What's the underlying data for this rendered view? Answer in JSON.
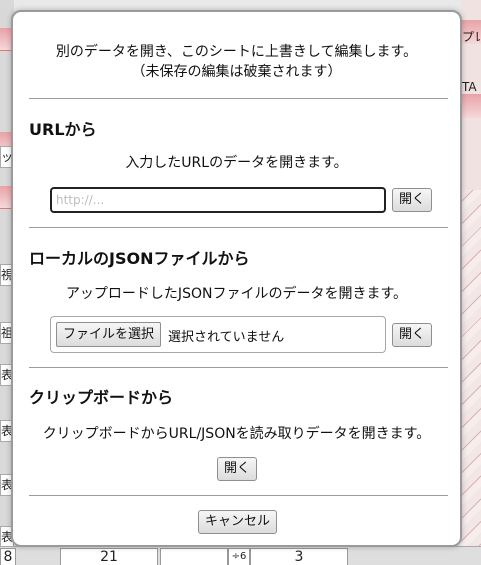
{
  "background": {
    "left_chars": [
      "ッ",
      "視",
      "祖",
      "表",
      "表",
      "表",
      "表",
      "8"
    ],
    "right_chars": [
      "プレ",
      "TA"
    ],
    "bottom_cells": [
      "21",
      "÷6",
      "3"
    ]
  },
  "dialog": {
    "intro_line1": "別のデータを開き、このシートに上書きして編集します。",
    "intro_line2": "（未保存の編集は破棄されます）",
    "url": {
      "heading": "URLから",
      "description": "入力したURLのデータを開きます。",
      "placeholder": "http://...",
      "open_label": "開く"
    },
    "json": {
      "heading": "ローカルのJSONファイルから",
      "description": "アップロードしたJSONファイルのデータを開きます。",
      "file_button_label": "ファイルを選択",
      "file_status": "選択されていません",
      "open_label": "開く"
    },
    "clipboard": {
      "heading": "クリップボードから",
      "description": "クリップボードからURL/JSONを読み取りデータを開きます。",
      "open_label": "開く"
    },
    "cancel_label": "キャンセル"
  }
}
